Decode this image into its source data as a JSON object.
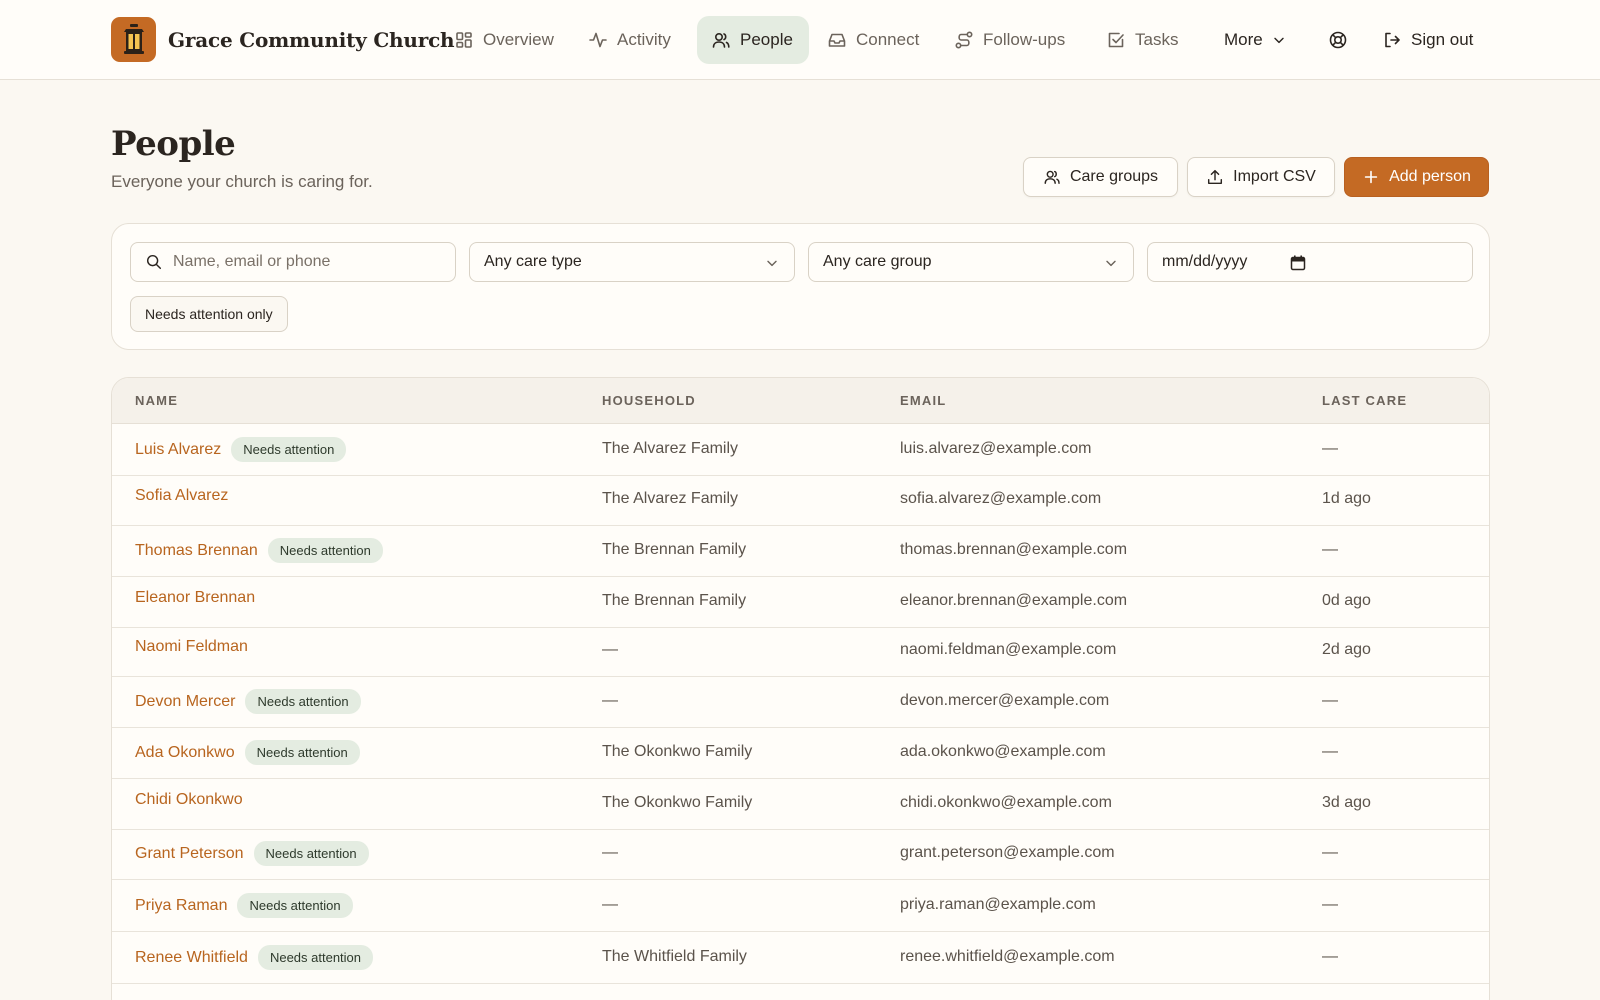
{
  "app": {
    "brand_name": "Grace Community Church"
  },
  "nav": {
    "items": [
      {
        "label": "Overview",
        "icon": "grid-icon"
      },
      {
        "label": "Activity",
        "icon": "pulse-icon"
      },
      {
        "label": "People",
        "icon": "users-icon",
        "active": true
      },
      {
        "label": "Connect",
        "icon": "inbox-icon"
      },
      {
        "label": "Follow-ups",
        "icon": "route-icon"
      },
      {
        "label": "Tasks",
        "icon": "checkbox-icon"
      }
    ],
    "more_label": "More",
    "sign_out_label": "Sign out"
  },
  "page": {
    "title": "People",
    "subtitle": "Everyone your church is caring for."
  },
  "actions": {
    "care_groups": "Care groups",
    "import_csv": "Import CSV",
    "add_person": "Add person"
  },
  "filters": {
    "search_placeholder": "Name, email or phone",
    "care_type": "Any care type",
    "care_group": "Any care group",
    "date_placeholder": "mm/dd/yyyy",
    "needs_attention_chip": "Needs attention only"
  },
  "table": {
    "columns": [
      "NAME",
      "HOUSEHOLD",
      "EMAIL",
      "LAST CARE"
    ],
    "badge_label": "Needs attention",
    "rows": [
      {
        "name": "Luis Alvarez",
        "needs_attention": true,
        "household": "The Alvarez Family",
        "email": "luis.alvarez@example.com",
        "last_care": "—"
      },
      {
        "name": "Sofia Alvarez",
        "needs_attention": false,
        "household": "The Alvarez Family",
        "email": "sofia.alvarez@example.com",
        "last_care": "1d ago"
      },
      {
        "name": "Thomas Brennan",
        "needs_attention": true,
        "household": "The Brennan Family",
        "email": "thomas.brennan@example.com",
        "last_care": "—"
      },
      {
        "name": "Eleanor Brennan",
        "needs_attention": false,
        "household": "The Brennan Family",
        "email": "eleanor.brennan@example.com",
        "last_care": "0d ago"
      },
      {
        "name": "Naomi Feldman",
        "needs_attention": false,
        "household": "—",
        "email": "naomi.feldman@example.com",
        "last_care": "2d ago"
      },
      {
        "name": "Devon Mercer",
        "needs_attention": true,
        "household": "—",
        "email": "devon.mercer@example.com",
        "last_care": "—"
      },
      {
        "name": "Ada Okonkwo",
        "needs_attention": true,
        "household": "The Okonkwo Family",
        "email": "ada.okonkwo@example.com",
        "last_care": "—"
      },
      {
        "name": "Chidi Okonkwo",
        "needs_attention": false,
        "household": "The Okonkwo Family",
        "email": "chidi.okonkwo@example.com",
        "last_care": "3d ago"
      },
      {
        "name": "Grant Peterson",
        "needs_attention": true,
        "household": "—",
        "email": "grant.peterson@example.com",
        "last_care": "—"
      },
      {
        "name": "Priya Raman",
        "needs_attention": true,
        "household": "—",
        "email": "priya.raman@example.com",
        "last_care": "—"
      },
      {
        "name": "Renee Whitfield",
        "needs_attention": true,
        "household": "The Whitfield Family",
        "email": "renee.whitfield@example.com",
        "last_care": "—"
      }
    ]
  },
  "colors": {
    "accent": "#c46a24",
    "link": "#b8651f",
    "badge_bg": "#e4ece1",
    "background": "#fbf8f2"
  }
}
